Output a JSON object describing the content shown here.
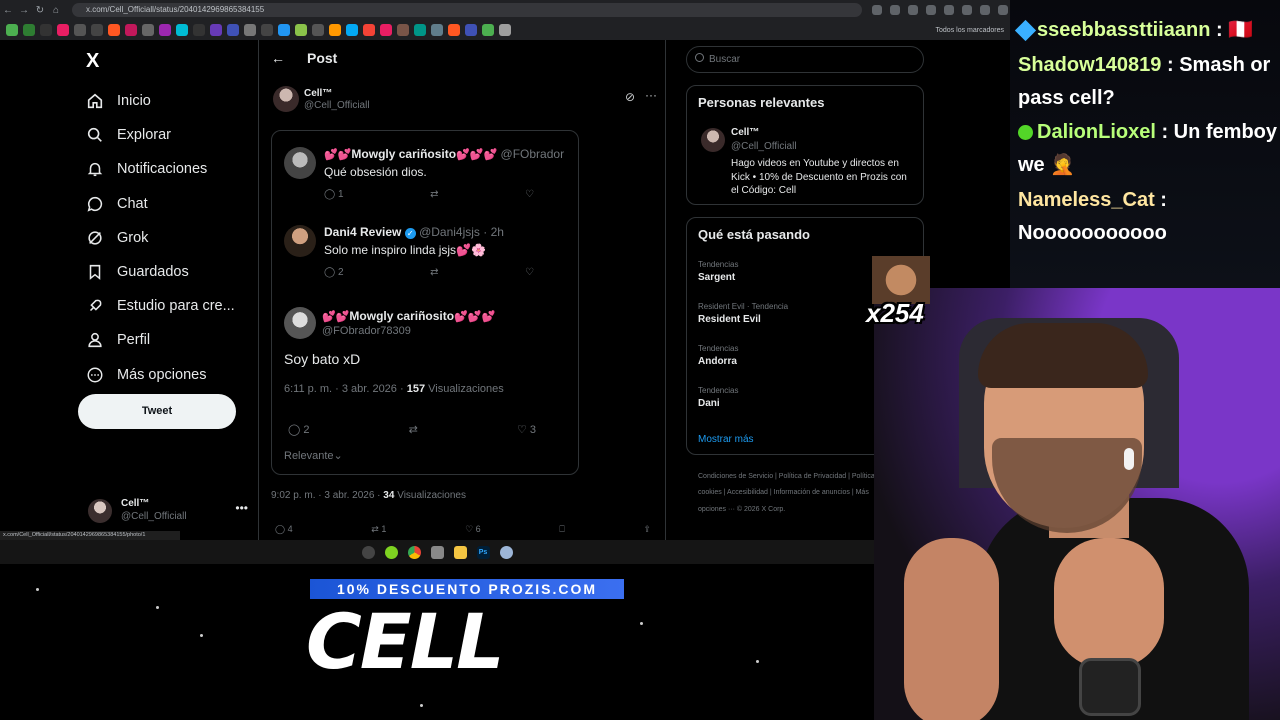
{
  "browser": {
    "url": "x.com/Cell_Officiall/status/2040142969865384155",
    "bookmarks_label": "Todos los marcadores",
    "status_url": "x.com/Cell_Officiall/status/2040142969865384155/photo/1"
  },
  "sidebar": {
    "logo": "X",
    "items": [
      {
        "label": "Inicio",
        "icon": "home-icon"
      },
      {
        "label": "Explorar",
        "icon": "search-icon"
      },
      {
        "label": "Notificaciones",
        "icon": "bell-icon"
      },
      {
        "label": "Chat",
        "icon": "chat-icon"
      },
      {
        "label": "Grok",
        "icon": "grok-icon"
      },
      {
        "label": "Guardados",
        "icon": "bookmark-icon"
      },
      {
        "label": "Estudio para cre...",
        "icon": "rocket-icon"
      },
      {
        "label": "Perfil",
        "icon": "person-icon"
      },
      {
        "label": "Más opciones",
        "icon": "more-circle-icon"
      }
    ],
    "tweet_button": "Tweet",
    "account": {
      "name": "Cell™",
      "handle": "@Cell_Officiall",
      "more": "•••"
    }
  },
  "post": {
    "header_title": "Post",
    "author": {
      "name": "Cell™",
      "handle": "@Cell_Officiall"
    },
    "quoted_thread": [
      {
        "hearts_left": "💕💕",
        "name": "Mowgly cariñosito",
        "hearts_right": "💕💕💕",
        "handle": "@FObrador",
        "time": "",
        "text": "Qué obsesión dios.",
        "replies": "1",
        "reposts": "",
        "likes": ""
      },
      {
        "hearts_left": "",
        "name": "Dani4 Review",
        "hearts_right": "",
        "handle": "@Dani4jsjs",
        "time": "· 2h",
        "text": "Solo me inspiro linda jsjs💕🌸",
        "replies": "2",
        "reposts": "",
        "likes": ""
      }
    ],
    "main_reply": {
      "hearts_left": "💕💕",
      "name": "Mowgly cariñosito",
      "hearts_right": "💕💕💕",
      "handle": "@FObrador78309",
      "text": "Soy bato xD",
      "timestamp": "6:11 p. m. · 3 abr. 2026 · ",
      "views_count": "157",
      "views_label": " Visualizaciones",
      "replies": "2",
      "reposts": "",
      "likes": "3",
      "relevante": "Relevante"
    },
    "outer_meta": {
      "timestamp": "9:02 p. m. · 3 abr. 2026 · ",
      "views_count": "34",
      "views_label": " Visualizaciones"
    },
    "outer_actions": {
      "replies": "4",
      "reposts": "1",
      "likes": "6"
    }
  },
  "right": {
    "search_placeholder": "Buscar",
    "relevant_title": "Personas relevantes",
    "relevant": {
      "name": "Cell™",
      "handle": "@Cell_Officiall",
      "bio": "Hago videos en Youtube y directos en Kick • 10% de Descuento en Prozis con el Código: Cell"
    },
    "trending_title": "Qué está pasando",
    "trends": [
      {
        "category": "Tendencias",
        "title": "Sargent"
      },
      {
        "category": "Resident Evil · Tendencia",
        "title": "Resident Evil"
      },
      {
        "category": "Tendencias",
        "title": "Andorra"
      },
      {
        "category": "Tendencias",
        "title": "Dani"
      }
    ],
    "show_more": "Mostrar más",
    "footer": "Condiciones de Servicio | Política de Privacidad | Política de cookies | Accesibilidad | Información de anuncios | Más opciones ··· © 2026 X Corp."
  },
  "overlay": {
    "promo": "10% DESCUENTO PROZIS.COM",
    "brand": "CELL",
    "emote_count": "x254"
  },
  "chat": [
    {
      "user": "sseebbassttiiaann",
      "message": " : 🇵🇪"
    },
    {
      "user": "Shadow140819",
      "message": " : Smash or pass cell?"
    },
    {
      "user": "DalionLioxel",
      "message": " : Un femboy we 🤦"
    },
    {
      "user": "Nameless_Cat",
      "message": " : Nooooooooooo"
    }
  ],
  "colors": {
    "accent": "#1d9bf0",
    "background": "#000000",
    "promo_blue": "#2a62e6"
  }
}
